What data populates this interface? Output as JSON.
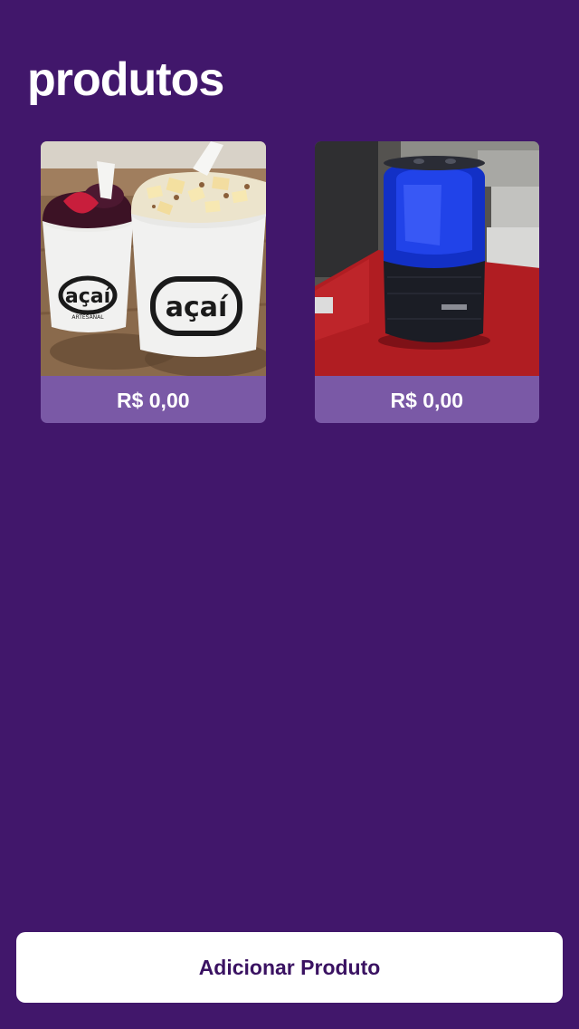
{
  "page": {
    "title": "produtos"
  },
  "products": [
    {
      "price": "R$ 0,00",
      "image_logo_text": "açaí",
      "image_logo_subtext": "ARTESANAL"
    },
    {
      "price": "R$ 0,00"
    }
  ],
  "actions": {
    "add_product_label": "Adicionar Produto"
  },
  "colors": {
    "background": "#41176b",
    "card_footer": "#7a59a6",
    "button_background": "#ffffff",
    "button_text": "#3a1262"
  }
}
